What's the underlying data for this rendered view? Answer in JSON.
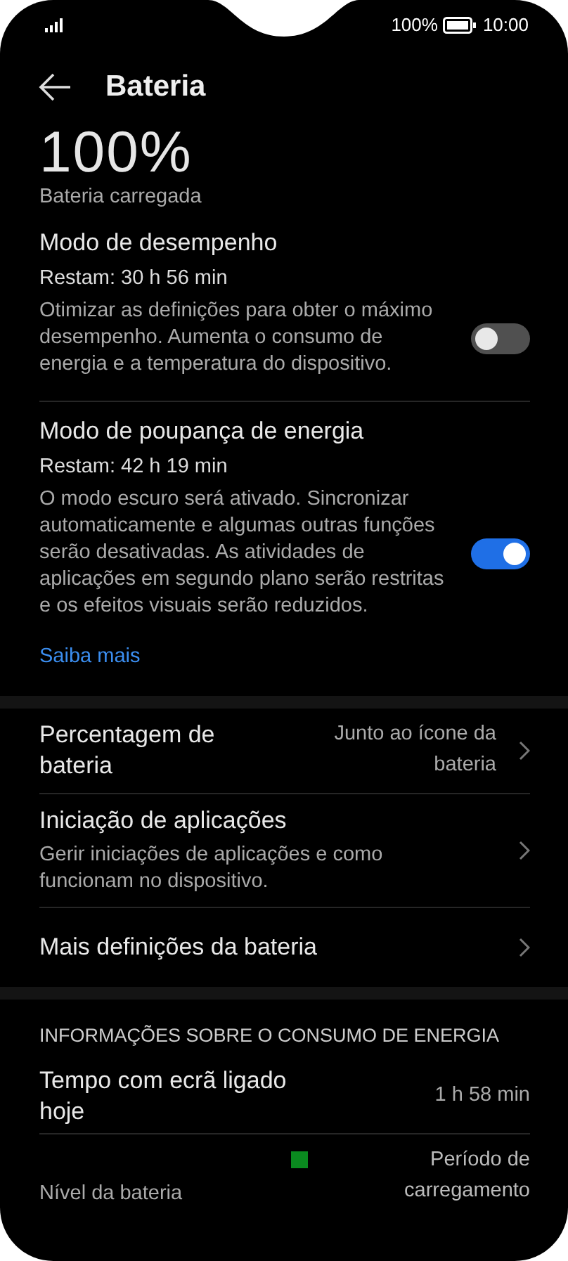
{
  "status_bar": {
    "battery": "100%",
    "time": "10:00"
  },
  "header": {
    "title": "Bateria"
  },
  "battery": {
    "percent": "100%",
    "status": "Bateria carregada"
  },
  "modes": [
    {
      "title": "Modo de desempenho",
      "remaining": "Restam: 30 h 56 min",
      "description": "Otimizar as definições para obter o máximo desempenho. Aumenta o consumo de energia e a temperatura do dispositivo.",
      "on": false
    },
    {
      "title": "Modo de poupança de energia",
      "remaining": "Restam: 42 h 19 min",
      "description": "O modo escuro será ativado. Sincronizar automaticamente e algumas outras funções serão desativadas. As atividades de aplicações em segundo plano serão restritas e os efeitos visuais serão reduzidos.",
      "on": true,
      "link": "Saiba mais"
    }
  ],
  "settings": [
    {
      "label": "Percentagem de bateria",
      "value": "Junto ao ícone da bateria"
    },
    {
      "label": "Iniciação de aplicações",
      "description": "Gerir iniciações de aplicações e como funcionam no dispositivo."
    },
    {
      "label": "Mais definições da bateria"
    }
  ],
  "consumption": {
    "heading": "INFORMAÇÕES SOBRE O CONSUMO DE ENERGIA",
    "screen_time": {
      "label": "Tempo com ecrã ligado hoje",
      "value": "1 h 58 min"
    },
    "chart_legend": {
      "label": "Nível da bateria",
      "items": [
        {
          "label": "Período de carregamento",
          "color": "#0a8a1f"
        }
      ]
    }
  }
}
